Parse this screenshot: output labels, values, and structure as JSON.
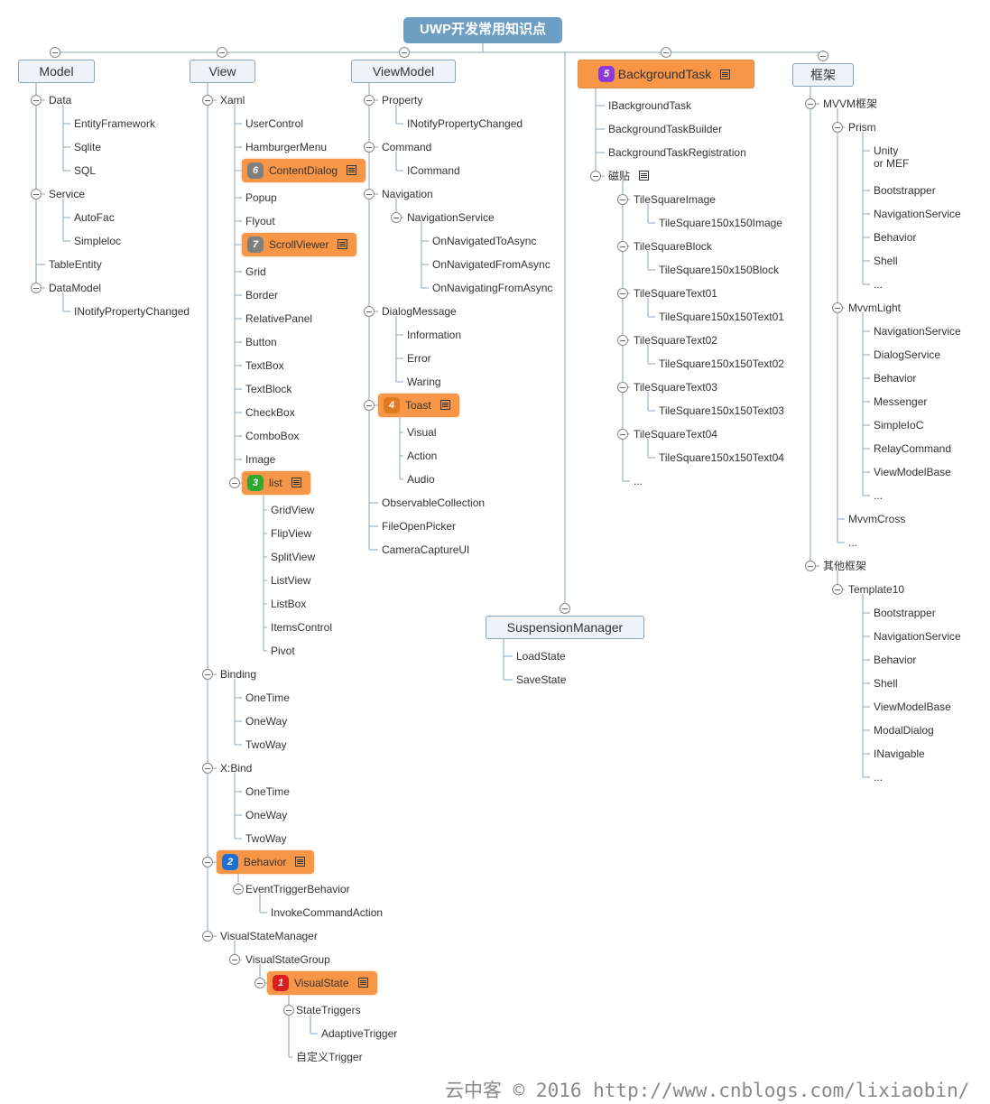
{
  "root": {
    "label": "UWP开发常用知识点"
  },
  "watermark": "云中客 © 2016  http://www.cnblogs.com/lixiaobin/",
  "colors": {
    "root": "#6d9ec4",
    "highlight": "#f79646",
    "line": "#8aa6bf"
  },
  "branches": [
    {
      "id": "model",
      "label": "Model",
      "children": [
        {
          "label": "Data",
          "children": [
            {
              "label": "EntityFramework"
            },
            {
              "label": "Sqlite"
            },
            {
              "label": "SQL"
            }
          ]
        },
        {
          "label": "Service",
          "children": [
            {
              "label": "AutoFac"
            },
            {
              "label": "Simpleloc"
            }
          ]
        },
        {
          "label": "TableEntity"
        },
        {
          "label": "DataModel",
          "children": [
            {
              "label": "INotifyPropertyChanged"
            }
          ]
        }
      ]
    },
    {
      "id": "view",
      "label": "View",
      "children": [
        {
          "label": "Xaml",
          "children": [
            {
              "label": "UserControl"
            },
            {
              "label": "HamburgerMenu"
            },
            {
              "label": "ContentDialog",
              "badge": "6",
              "badge_color": "#7f7f7f",
              "note": true
            },
            {
              "label": "Popup"
            },
            {
              "label": "Flyout"
            },
            {
              "label": "ScrollViewer",
              "badge": "7",
              "badge_color": "#7f7f7f",
              "note": true
            },
            {
              "label": "Grid"
            },
            {
              "label": "Border"
            },
            {
              "label": "RelativePanel"
            },
            {
              "label": "Button"
            },
            {
              "label": "TextBox"
            },
            {
              "label": "TextBlock"
            },
            {
              "label": "CheckBox"
            },
            {
              "label": "ComboBox"
            },
            {
              "label": "Image"
            },
            {
              "label": "list",
              "badge": "3",
              "badge_color": "#2ea82e",
              "note": true,
              "children": [
                {
                  "label": "GridView"
                },
                {
                  "label": "FlipView"
                },
                {
                  "label": "SplitView"
                },
                {
                  "label": "ListView"
                },
                {
                  "label": "ListBox"
                },
                {
                  "label": "ItemsControl"
                },
                {
                  "label": "Pivot"
                }
              ]
            }
          ]
        },
        {
          "label": "Binding",
          "children": [
            {
              "label": "OneTime"
            },
            {
              "label": "OneWay"
            },
            {
              "label": "TwoWay"
            }
          ]
        },
        {
          "label": "X:Bind",
          "children": [
            {
              "label": "OneTime"
            },
            {
              "label": "OneWay"
            },
            {
              "label": "TwoWay"
            }
          ]
        },
        {
          "label": "Behavior",
          "badge": "2",
          "badge_color": "#1f6fd1",
          "note": true,
          "children": [
            {
              "label": "EventTriggerBehavior",
              "children": [
                {
                  "label": "InvokeCommandAction"
                }
              ]
            }
          ]
        },
        {
          "label": "VisualStateManager",
          "children": [
            {
              "label": "VisualStateGroup",
              "children": [
                {
                  "label": "VisualState",
                  "badge": "1",
                  "badge_color": "#d92020",
                  "note": true,
                  "children": [
                    {
                      "label": "StateTriggers",
                      "children": [
                        {
                          "label": "AdaptiveTrigger"
                        }
                      ]
                    },
                    {
                      "label": "自定义Trigger"
                    }
                  ]
                }
              ]
            }
          ]
        }
      ]
    },
    {
      "id": "viewmodel",
      "label": "ViewModel",
      "children": [
        {
          "label": "Property",
          "children": [
            {
              "label": "INotifyPropertyChanged"
            }
          ]
        },
        {
          "label": "Command",
          "children": [
            {
              "label": "ICommand"
            }
          ]
        },
        {
          "label": "Navigation",
          "children": [
            {
              "label": "NavigationService",
              "children": [
                {
                  "label": "OnNavigatedToAsync"
                },
                {
                  "label": "OnNavigatedFromAsync"
                },
                {
                  "label": "OnNavigatingFromAsync"
                }
              ]
            }
          ]
        },
        {
          "label": "DialogMessage",
          "children": [
            {
              "label": "Information"
            },
            {
              "label": "Error"
            },
            {
              "label": "Waring"
            }
          ]
        },
        {
          "label": "Toast",
          "badge": "4",
          "badge_color": "#e07a1f",
          "note": true,
          "children": [
            {
              "label": "Visual"
            },
            {
              "label": "Action"
            },
            {
              "label": "Audio"
            }
          ]
        },
        {
          "label": "ObservableCollection"
        },
        {
          "label": "FileOpenPicker"
        },
        {
          "label": "CameraCaptureUI"
        }
      ]
    },
    {
      "id": "suspension",
      "label": "SuspensionManager",
      "children": [
        {
          "label": "LoadState"
        },
        {
          "label": "SaveState"
        }
      ]
    },
    {
      "id": "backgroundtask",
      "label": "BackgroundTask",
      "badge": "5",
      "badge_color": "#8a3ad6",
      "note": true,
      "children": [
        {
          "label": "IBackgroundTask"
        },
        {
          "label": "BackgroundTaskBuilder"
        },
        {
          "label": "BackgroundTaskRegistration"
        },
        {
          "label": "磁贴",
          "note": true,
          "children": [
            {
              "label": "TileSquareImage",
              "children": [
                {
                  "label": "TileSquare150x150Image"
                }
              ]
            },
            {
              "label": "TileSquareBlock",
              "children": [
                {
                  "label": "TileSquare150x150Block"
                }
              ]
            },
            {
              "label": "TileSquareText01",
              "children": [
                {
                  "label": "TileSquare150x150Text01"
                }
              ]
            },
            {
              "label": "TileSquareText02",
              "children": [
                {
                  "label": "TileSquare150x150Text02"
                }
              ]
            },
            {
              "label": "TileSquareText03",
              "children": [
                {
                  "label": "TileSquare150x150Text03"
                }
              ]
            },
            {
              "label": "TileSquareText04",
              "children": [
                {
                  "label": "TileSquare150x150Text04"
                }
              ]
            },
            {
              "label": "..."
            }
          ]
        }
      ]
    },
    {
      "id": "framework",
      "label": "框架",
      "children": [
        {
          "label": "MVVM框架",
          "children": [
            {
              "label": "Prism",
              "children": [
                {
                  "label": "Unity\nor MEF"
                },
                {
                  "label": "Bootstrapper"
                },
                {
                  "label": "NavigationService"
                },
                {
                  "label": "Behavior"
                },
                {
                  "label": "Shell"
                },
                {
                  "label": "..."
                }
              ]
            },
            {
              "label": "MvvmLight",
              "children": [
                {
                  "label": "NavigationService"
                },
                {
                  "label": "DialogService"
                },
                {
                  "label": "Behavior"
                },
                {
                  "label": "Messenger"
                },
                {
                  "label": "SimpleIoC"
                },
                {
                  "label": "RelayCommand"
                },
                {
                  "label": "ViewModelBase"
                },
                {
                  "label": "..."
                }
              ]
            },
            {
              "label": "MvvmCross"
            },
            {
              "label": "..."
            }
          ]
        },
        {
          "label": "其他框架",
          "children": [
            {
              "label": "Template10",
              "children": [
                {
                  "label": "Bootstrapper"
                },
                {
                  "label": "NavigationService"
                },
                {
                  "label": "Behavior"
                },
                {
                  "label": "Shell"
                },
                {
                  "label": "ViewModelBase"
                },
                {
                  "label": "ModalDialog"
                },
                {
                  "label": "INavigable"
                },
                {
                  "label": "..."
                }
              ]
            }
          ]
        }
      ]
    }
  ]
}
